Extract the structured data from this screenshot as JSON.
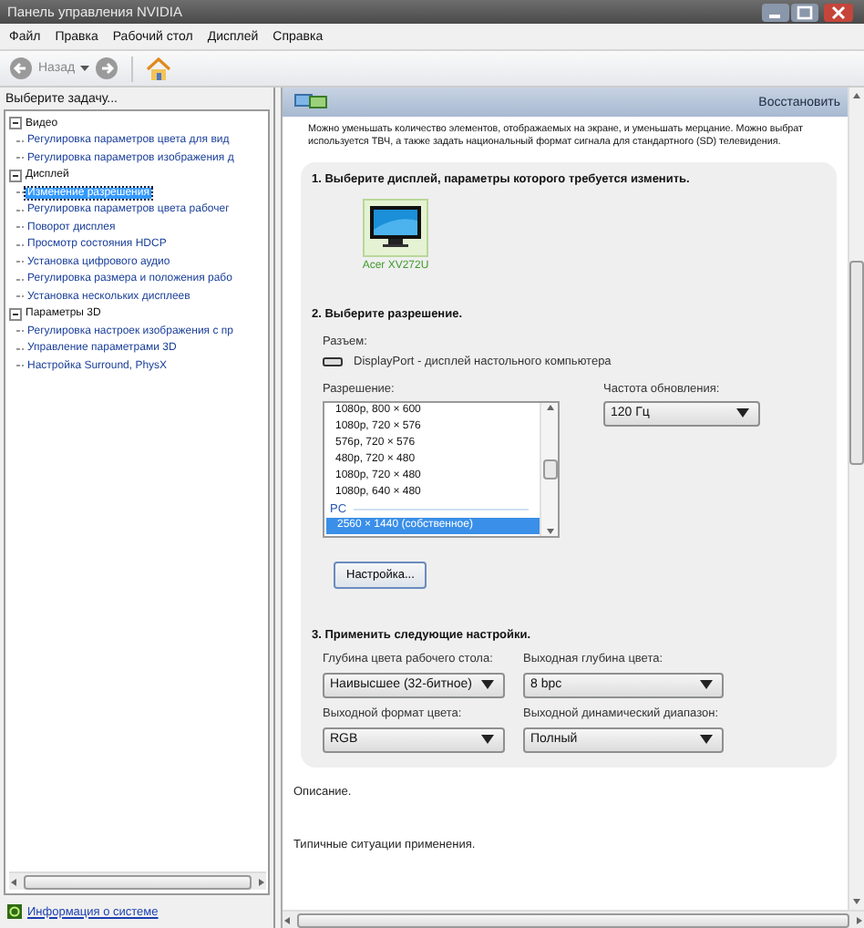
{
  "window": {
    "title": "Панель управления NVIDIA"
  },
  "menu": [
    "Файл",
    "Правка",
    "Рабочий стол",
    "Дисплей",
    "Справка"
  ],
  "toolbar": {
    "back_label": "Назад"
  },
  "sidebar": {
    "heading": "Выберите задачу...",
    "tree": [
      {
        "label": "Видео",
        "expanded": true,
        "children": [
          {
            "label": "Регулировка параметров цвета для вид",
            "selected": false
          },
          {
            "label": "Регулировка параметров изображения д",
            "selected": false
          }
        ]
      },
      {
        "label": "Дисплей",
        "expanded": true,
        "children": [
          {
            "label": "Изменение разрешения",
            "selected": true
          },
          {
            "label": "Регулировка параметров цвета рабочег",
            "selected": false
          },
          {
            "label": "Поворот дисплея",
            "selected": false
          },
          {
            "label": "Просмотр состояния HDCP",
            "selected": false
          },
          {
            "label": "Установка цифрового аудио",
            "selected": false
          },
          {
            "label": "Регулировка размера и положения рабо",
            "selected": false
          },
          {
            "label": "Установка нескольких дисплеев",
            "selected": false
          }
        ]
      },
      {
        "label": "Параметры 3D",
        "expanded": true,
        "children": [
          {
            "label": "Регулировка настроек изображения с пр",
            "selected": false
          },
          {
            "label": "Управление параметрами 3D",
            "selected": false
          },
          {
            "label": "Настройка Surround, PhysX",
            "selected": false
          }
        ]
      }
    ],
    "footer_link": "Информация о системе"
  },
  "content": {
    "restore_button": "Восстановить",
    "intro": [
      "Можно уменьшать количество элементов, отображаемых на экране, и уменьшать мерцание. Можно выбрат",
      "используется ТВЧ, а также задать национальный формат сигнала для стандартного (SD) телевидения."
    ],
    "step1": {
      "title": "1. Выберите дисплей, параметры которого требуется изменить.",
      "displays": [
        {
          "name": "Acer XV272U",
          "selected": true
        }
      ]
    },
    "step2": {
      "title": "2. Выберите разрешение.",
      "connector_label": "Разъем:",
      "connector": "DisplayPort - дисплей настольного компьютера",
      "resolution_label": "Разрешение:",
      "resolutions": [
        {
          "kind": "item",
          "label": "1080p, 800 × 600",
          "selected": false
        },
        {
          "kind": "item",
          "label": "1080p, 720 × 576",
          "selected": false
        },
        {
          "kind": "item",
          "label": "576p, 720 × 576",
          "selected": false
        },
        {
          "kind": "item",
          "label": "480p, 720 × 480",
          "selected": false
        },
        {
          "kind": "item",
          "label": "1080p, 720 × 480",
          "selected": false
        },
        {
          "kind": "item",
          "label": "1080p, 640 × 480",
          "selected": false
        },
        {
          "kind": "group",
          "label": "PC"
        },
        {
          "kind": "item",
          "label": "2560 × 1440 (собственное)",
          "selected": true
        }
      ],
      "refresh_label": "Частота обновления:",
      "refresh_value": "120 Гц",
      "customize_button": "Настройка..."
    },
    "step3": {
      "title": "3. Применить следующие настройки.",
      "fields": [
        {
          "label": "Глубина цвета рабочего стола:",
          "value": "Наивысшее (32-битное)"
        },
        {
          "label": "Выходная глубина цвета:",
          "value": "8 bpc"
        },
        {
          "label": "Выходной формат цвета:",
          "value": "RGB"
        },
        {
          "label": "Выходной динамический диапазон:",
          "value": "Полный"
        }
      ]
    },
    "description": "Описание.",
    "usage": "Типичные ситуации применения."
  }
}
